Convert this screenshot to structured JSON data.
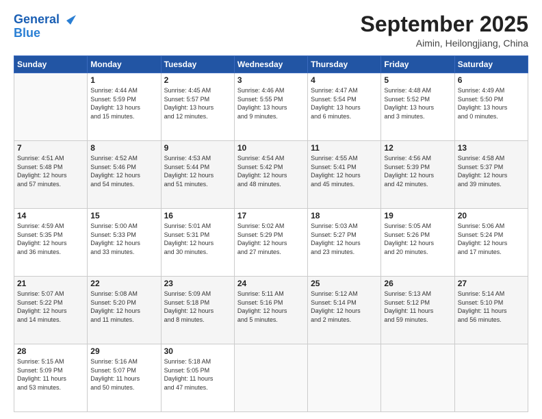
{
  "header": {
    "logo_line1": "General",
    "logo_line2": "Blue",
    "month": "September 2025",
    "location": "Aimin, Heilongjiang, China"
  },
  "weekdays": [
    "Sunday",
    "Monday",
    "Tuesday",
    "Wednesday",
    "Thursday",
    "Friday",
    "Saturday"
  ],
  "weeks": [
    [
      {
        "day": "",
        "info": ""
      },
      {
        "day": "1",
        "info": "Sunrise: 4:44 AM\nSunset: 5:59 PM\nDaylight: 13 hours\nand 15 minutes."
      },
      {
        "day": "2",
        "info": "Sunrise: 4:45 AM\nSunset: 5:57 PM\nDaylight: 13 hours\nand 12 minutes."
      },
      {
        "day": "3",
        "info": "Sunrise: 4:46 AM\nSunset: 5:55 PM\nDaylight: 13 hours\nand 9 minutes."
      },
      {
        "day": "4",
        "info": "Sunrise: 4:47 AM\nSunset: 5:54 PM\nDaylight: 13 hours\nand 6 minutes."
      },
      {
        "day": "5",
        "info": "Sunrise: 4:48 AM\nSunset: 5:52 PM\nDaylight: 13 hours\nand 3 minutes."
      },
      {
        "day": "6",
        "info": "Sunrise: 4:49 AM\nSunset: 5:50 PM\nDaylight: 13 hours\nand 0 minutes."
      }
    ],
    [
      {
        "day": "7",
        "info": "Sunrise: 4:51 AM\nSunset: 5:48 PM\nDaylight: 12 hours\nand 57 minutes."
      },
      {
        "day": "8",
        "info": "Sunrise: 4:52 AM\nSunset: 5:46 PM\nDaylight: 12 hours\nand 54 minutes."
      },
      {
        "day": "9",
        "info": "Sunrise: 4:53 AM\nSunset: 5:44 PM\nDaylight: 12 hours\nand 51 minutes."
      },
      {
        "day": "10",
        "info": "Sunrise: 4:54 AM\nSunset: 5:42 PM\nDaylight: 12 hours\nand 48 minutes."
      },
      {
        "day": "11",
        "info": "Sunrise: 4:55 AM\nSunset: 5:41 PM\nDaylight: 12 hours\nand 45 minutes."
      },
      {
        "day": "12",
        "info": "Sunrise: 4:56 AM\nSunset: 5:39 PM\nDaylight: 12 hours\nand 42 minutes."
      },
      {
        "day": "13",
        "info": "Sunrise: 4:58 AM\nSunset: 5:37 PM\nDaylight: 12 hours\nand 39 minutes."
      }
    ],
    [
      {
        "day": "14",
        "info": "Sunrise: 4:59 AM\nSunset: 5:35 PM\nDaylight: 12 hours\nand 36 minutes."
      },
      {
        "day": "15",
        "info": "Sunrise: 5:00 AM\nSunset: 5:33 PM\nDaylight: 12 hours\nand 33 minutes."
      },
      {
        "day": "16",
        "info": "Sunrise: 5:01 AM\nSunset: 5:31 PM\nDaylight: 12 hours\nand 30 minutes."
      },
      {
        "day": "17",
        "info": "Sunrise: 5:02 AM\nSunset: 5:29 PM\nDaylight: 12 hours\nand 27 minutes."
      },
      {
        "day": "18",
        "info": "Sunrise: 5:03 AM\nSunset: 5:27 PM\nDaylight: 12 hours\nand 23 minutes."
      },
      {
        "day": "19",
        "info": "Sunrise: 5:05 AM\nSunset: 5:26 PM\nDaylight: 12 hours\nand 20 minutes."
      },
      {
        "day": "20",
        "info": "Sunrise: 5:06 AM\nSunset: 5:24 PM\nDaylight: 12 hours\nand 17 minutes."
      }
    ],
    [
      {
        "day": "21",
        "info": "Sunrise: 5:07 AM\nSunset: 5:22 PM\nDaylight: 12 hours\nand 14 minutes."
      },
      {
        "day": "22",
        "info": "Sunrise: 5:08 AM\nSunset: 5:20 PM\nDaylight: 12 hours\nand 11 minutes."
      },
      {
        "day": "23",
        "info": "Sunrise: 5:09 AM\nSunset: 5:18 PM\nDaylight: 12 hours\nand 8 minutes."
      },
      {
        "day": "24",
        "info": "Sunrise: 5:11 AM\nSunset: 5:16 PM\nDaylight: 12 hours\nand 5 minutes."
      },
      {
        "day": "25",
        "info": "Sunrise: 5:12 AM\nSunset: 5:14 PM\nDaylight: 12 hours\nand 2 minutes."
      },
      {
        "day": "26",
        "info": "Sunrise: 5:13 AM\nSunset: 5:12 PM\nDaylight: 11 hours\nand 59 minutes."
      },
      {
        "day": "27",
        "info": "Sunrise: 5:14 AM\nSunset: 5:10 PM\nDaylight: 11 hours\nand 56 minutes."
      }
    ],
    [
      {
        "day": "28",
        "info": "Sunrise: 5:15 AM\nSunset: 5:09 PM\nDaylight: 11 hours\nand 53 minutes."
      },
      {
        "day": "29",
        "info": "Sunrise: 5:16 AM\nSunset: 5:07 PM\nDaylight: 11 hours\nand 50 minutes."
      },
      {
        "day": "30",
        "info": "Sunrise: 5:18 AM\nSunset: 5:05 PM\nDaylight: 11 hours\nand 47 minutes."
      },
      {
        "day": "",
        "info": ""
      },
      {
        "day": "",
        "info": ""
      },
      {
        "day": "",
        "info": ""
      },
      {
        "day": "",
        "info": ""
      }
    ]
  ]
}
